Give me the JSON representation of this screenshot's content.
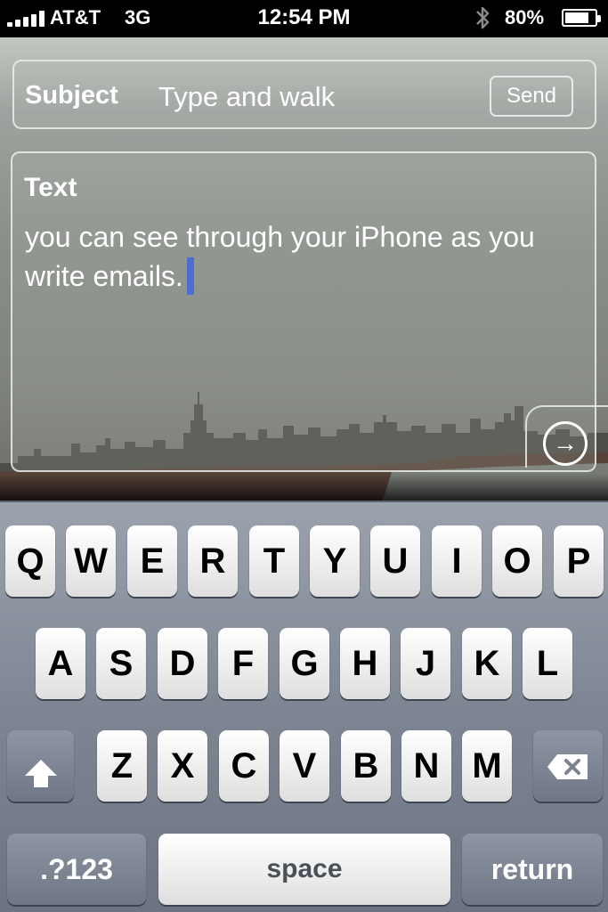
{
  "status": {
    "carrier": "AT&T",
    "network": "3G",
    "time": "12:54 PM",
    "battery": "80%",
    "battery_level": 0.8,
    "icons": [
      "signal-bars-icon",
      "bluetooth-icon",
      "battery-icon"
    ]
  },
  "compose": {
    "subject_label": "Subject",
    "subject_value": "Type and walk",
    "send_label": "Send",
    "text_label": "Text",
    "body": "you can see through your iPhone as you write emails.",
    "go_icon": "arrow-right-circle-icon"
  },
  "keyboard": {
    "rows": [
      [
        "Q",
        "W",
        "E",
        "R",
        "T",
        "Y",
        "U",
        "I",
        "O",
        "P"
      ],
      [
        "A",
        "S",
        "D",
        "F",
        "G",
        "H",
        "J",
        "K",
        "L"
      ],
      [
        "Z",
        "X",
        "C",
        "V",
        "B",
        "N",
        "M"
      ]
    ],
    "numbers_label": ".?123",
    "space_label": "space",
    "return_label": "return",
    "shift_icon": "shift-arrow-icon",
    "delete_icon": "backspace-icon"
  },
  "colors": {
    "caret": "#4f6dd0",
    "keyboard_bg": "#7e8694"
  }
}
